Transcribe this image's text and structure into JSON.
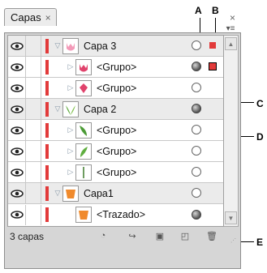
{
  "callouts": {
    "a": "A",
    "b": "B",
    "c": "C",
    "d": "D",
    "e": "E"
  },
  "panel": {
    "tab_label": "Capas",
    "tab_close": "×",
    "window_close": "×",
    "menu_icon": "▾≡"
  },
  "rows": [
    {
      "type": "layer",
      "label": "Capa 3",
      "expanded": true,
      "thumb": "tulip-pink",
      "target": "empty",
      "selected": "small"
    },
    {
      "type": "sub",
      "label": "<Grupo>",
      "expanded": false,
      "thumb": "tulip-pink",
      "target": "filled",
      "selected": "outlined"
    },
    {
      "type": "sub",
      "label": "<Grupo>",
      "expanded": false,
      "thumb": "tulip-pink-2",
      "target": "empty",
      "selected": ""
    },
    {
      "type": "layer",
      "label": "Capa 2",
      "expanded": true,
      "thumb": "leaves-green",
      "target": "filled",
      "selected": ""
    },
    {
      "type": "sub",
      "label": "<Grupo>",
      "expanded": false,
      "thumb": "leaf-green",
      "target": "empty",
      "selected": ""
    },
    {
      "type": "sub",
      "label": "<Grupo>",
      "expanded": false,
      "thumb": "leaf-green-2",
      "target": "empty",
      "selected": ""
    },
    {
      "type": "sub",
      "label": "<Grupo>",
      "expanded": false,
      "thumb": "stem",
      "target": "empty",
      "selected": ""
    },
    {
      "type": "layer",
      "label": "Capa1",
      "expanded": true,
      "thumb": "pot-orange",
      "target": "empty",
      "selected": ""
    },
    {
      "type": "sub",
      "label": "<Trazado>",
      "expanded": null,
      "thumb": "pot-orange",
      "target": "filled",
      "selected": ""
    }
  ],
  "footer": {
    "count": "3 capas"
  },
  "colors": {
    "layer_color": "#e23a3a"
  }
}
